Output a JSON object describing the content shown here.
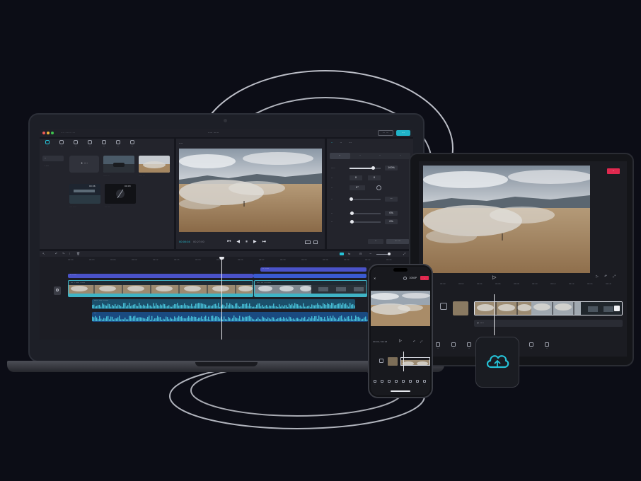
{
  "colors": {
    "background": "#0c0d16",
    "accent": "#25c3d8",
    "export": "#20b3c8",
    "tablet_export": "#e0294f",
    "phone_export": "#e0294f",
    "video_track": "#3fb4c6",
    "text_track": "#4a52c8",
    "audio_track": "#1f7fa0"
  },
  "laptop": {
    "titlebar": {
      "project_menu": "···· ······ ····",
      "title": "····· ······",
      "share_label": "··· ···",
      "export_label": "···"
    },
    "media_panel": {
      "tools": [
        {
          "label": "··",
          "icon": "media-icon",
          "active": true
        },
        {
          "label": "··",
          "icon": "audio-icon",
          "active": false
        },
        {
          "label": "··",
          "icon": "text-icon",
          "active": false
        },
        {
          "label": "··",
          "icon": "sticker-icon",
          "active": false
        },
        {
          "label": "··",
          "icon": "effects-icon",
          "active": false
        },
        {
          "label": "··",
          "icon": "transition-icon",
          "active": false
        },
        {
          "label": "··",
          "icon": "filter-icon",
          "active": false
        }
      ],
      "side_nav": [
        "··",
        "· ···"
      ],
      "import_label": "+ ····",
      "thumbs": [
        {
          "dur": "00:05",
          "caption": "····· ···"
        },
        {
          "dur": "00:04",
          "caption": "····· ···"
        },
        {
          "dur": "00:06",
          "caption": "···· ·····"
        },
        {
          "dur": "00:03",
          "caption": "··· ····"
        }
      ]
    },
    "preview": {
      "label": "····",
      "current_time": "00:00:04",
      "total_time": "00:27:00",
      "controls": [
        "⏮",
        "◀",
        "⏸",
        "▶",
        "⏭"
      ]
    },
    "properties": {
      "tabs": [
        "··",
        "··",
        "···"
      ],
      "subtabs": [
        "··",
        "··",
        "··",
        "··"
      ],
      "rows": [
        {
          "label": "·····",
          "value": "100%",
          "fill": 0.75
        },
        {
          "label": "··",
          "value": "0",
          "fill": 0.0
        },
        {
          "label": "··",
          "value": "0°",
          "fill": 0.0
        },
        {
          "label": "··",
          "value": "···",
          "fill": 0.0
        },
        {
          "label": "··",
          "value": "0%",
          "fill": 0.05
        },
        {
          "label": "··",
          "value": "0%",
          "fill": 0.05
        }
      ],
      "reset_label": "··",
      "apply_label": "··· ···"
    },
    "timeline": {
      "ruler_marks": [
        "00:00",
        "00:03",
        "00:06",
        "00:09",
        "00:12",
        "00:15",
        "00:18",
        "00:21",
        "00:24",
        "00:27",
        "00:30",
        "00:33",
        "00:36",
        "00:39",
        "00:42",
        "00:45"
      ],
      "tracks": {
        "text1": "·· ·····",
        "text2": "·· ·····",
        "video1": "··· · ····· ······",
        "video2": "···· ··· · ·······",
        "audio1": "····· ···· ·······",
        "audio2": "···"
      }
    }
  },
  "tablet": {
    "export_label": "··",
    "res_label": "1080P",
    "ruler_marks": [
      "00:00",
      "00:02",
      "00:04",
      "00:06",
      "00:08",
      "00:10",
      "00:12",
      "00:14",
      "00:16",
      "00:18"
    ],
    "add_audio": "+ ····",
    "tools": [
      "··",
      "··",
      "··",
      "··",
      "··",
      "··",
      "··",
      "··"
    ]
  },
  "phone": {
    "res_label": "1080P",
    "export_label": "··",
    "time": "00:00 / 00:18",
    "tools": [
      "··",
      "··",
      "··",
      "··",
      "··",
      "··",
      "··",
      "··"
    ]
  },
  "cloud": {
    "icon": "cloud-icon"
  }
}
